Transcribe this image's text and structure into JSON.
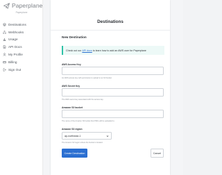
{
  "brand": {
    "name": "Paperplane",
    "subtitle": "Paperplane"
  },
  "sidebar": {
    "items": [
      {
        "label": "Destinations",
        "icon": "stack-icon"
      },
      {
        "label": "Webhooks",
        "icon": "webhook-icon"
      },
      {
        "label": "Usage",
        "icon": "chart-icon"
      },
      {
        "label": "API Docs",
        "icon": "doc-icon"
      },
      {
        "label": "My Profile",
        "icon": "user-icon"
      },
      {
        "label": "Billing",
        "icon": "card-icon"
      },
      {
        "label": "Sign Out",
        "icon": "logout-icon"
      }
    ]
  },
  "panel": {
    "title": "Destinations",
    "section_title": "New Destination",
    "notice": {
      "prefix": "Check out our",
      "link": "API docs",
      "suffix": "to learn how to add an AWS user for Paperplane"
    },
    "fields": [
      {
        "label": "AWS Access Key",
        "value": "",
        "help": "An AWS access key with permission to upload to an S3 bucket."
      },
      {
        "label": "AWS Secret Key",
        "value": "",
        "help": "The AWS secret key associated with the access key."
      },
      {
        "label": "Amazon S3 bucket",
        "value": "",
        "help": "The name of the Amazon S3 bucket that PDFs will be uploaded to."
      }
    ],
    "region": {
      "label": "Amazon S3 region",
      "value": "ap-northeast-1",
      "help": "The Amazon S3 region where the bucket is located."
    },
    "create_label": "Create Destination",
    "cancel_label": "Cancel"
  },
  "colors": {
    "accent": "#2b6fd1",
    "notice_bar": "#2dc1a6",
    "notice_bg": "#edf9f7"
  }
}
